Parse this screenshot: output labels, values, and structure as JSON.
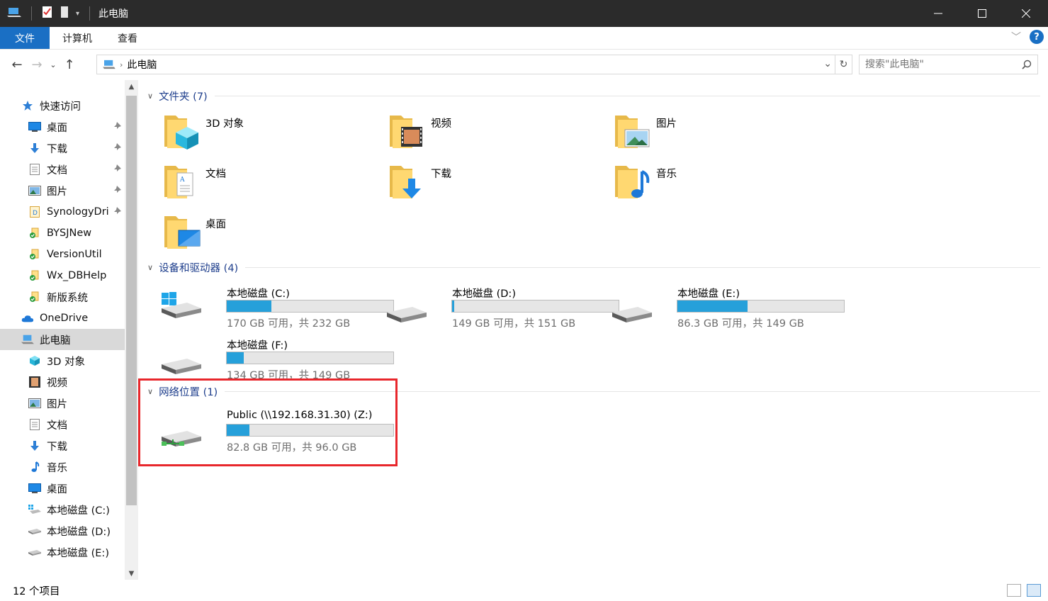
{
  "window": {
    "title": "此电脑"
  },
  "ribbon": {
    "tabs": [
      "文件",
      "计算机",
      "查看"
    ]
  },
  "address": {
    "path": "此电脑"
  },
  "search": {
    "placeholder": "搜索\"此电脑\""
  },
  "sidebar": {
    "items": [
      {
        "label": "快速访问",
        "icon": "star-icon",
        "indent": 0
      },
      {
        "label": "桌面",
        "icon": "desktop-icon",
        "indent": 1,
        "pinned": true
      },
      {
        "label": "下载",
        "icon": "download-icon",
        "indent": 1,
        "pinned": true
      },
      {
        "label": "文档",
        "icon": "document-icon",
        "indent": 1,
        "pinned": true
      },
      {
        "label": "图片",
        "icon": "picture-icon",
        "indent": 1,
        "pinned": true
      },
      {
        "label": "SynologyDri",
        "icon": "synology-icon",
        "indent": 1,
        "pinned": true
      },
      {
        "label": "BYSJNew",
        "icon": "synced-folder-icon",
        "indent": 1
      },
      {
        "label": "VersionUtil",
        "icon": "synced-folder-icon",
        "indent": 1
      },
      {
        "label": "Wx_DBHelp",
        "icon": "synced-folder-icon",
        "indent": 1
      },
      {
        "label": "新版系统",
        "icon": "synced-folder-icon",
        "indent": 1
      },
      {
        "label": "OneDrive",
        "icon": "cloud-icon",
        "indent": 0
      },
      {
        "label": "此电脑",
        "icon": "computer-icon",
        "indent": 0,
        "selected": true
      },
      {
        "label": "3D 对象",
        "icon": "cube-icon",
        "indent": 1
      },
      {
        "label": "视频",
        "icon": "video-icon",
        "indent": 1
      },
      {
        "label": "图片",
        "icon": "picture-icon",
        "indent": 1
      },
      {
        "label": "文档",
        "icon": "document-icon",
        "indent": 1
      },
      {
        "label": "下载",
        "icon": "download-icon",
        "indent": 1
      },
      {
        "label": "音乐",
        "icon": "music-icon",
        "indent": 1
      },
      {
        "label": "桌面",
        "icon": "desktop-icon",
        "indent": 1
      },
      {
        "label": "本地磁盘 (C:)",
        "icon": "windows-drive-icon",
        "indent": 1
      },
      {
        "label": "本地磁盘 (D:)",
        "icon": "drive-icon",
        "indent": 1
      },
      {
        "label": "本地磁盘 (E:)",
        "icon": "drive-icon",
        "indent": 1
      }
    ]
  },
  "groups": {
    "folders": {
      "title": "文件夹 (7)"
    },
    "drives": {
      "title": "设备和驱动器 (4)"
    },
    "network": {
      "title": "网络位置 (1)"
    }
  },
  "folders": [
    {
      "name": "3D 对象",
      "overlay": "cube"
    },
    {
      "name": "视频",
      "overlay": "film"
    },
    {
      "name": "图片",
      "overlay": "picture"
    },
    {
      "name": "文档",
      "overlay": "document"
    },
    {
      "name": "下载",
      "overlay": "download"
    },
    {
      "name": "音乐",
      "overlay": "music"
    },
    {
      "name": "桌面",
      "overlay": "desktop"
    }
  ],
  "drives": [
    {
      "name": "本地磁盘 (C:)",
      "free": "170 GB 可用，共 232 GB",
      "used_fraction": 0.267,
      "icon": "windows-drive-icon"
    },
    {
      "name": "本地磁盘 (D:)",
      "free": "149 GB 可用，共 151 GB",
      "used_fraction": 0.013,
      "icon": "drive-icon"
    },
    {
      "name": "本地磁盘 (E:)",
      "free": "86.3 GB 可用，共 149 GB",
      "used_fraction": 0.421,
      "icon": "drive-icon"
    },
    {
      "name": "本地磁盘 (F:)",
      "free": "134 GB 可用，共 149 GB",
      "used_fraction": 0.1,
      "icon": "drive-icon"
    }
  ],
  "network": [
    {
      "name": "Public (\\\\192.168.31.30) (Z:)",
      "free": "82.8 GB 可用，共 96.0 GB",
      "used_fraction": 0.1375,
      "icon": "network-drive-icon"
    }
  ],
  "status": {
    "count": "12 个项目"
  },
  "colors": {
    "accent": "#1a6fc4",
    "bar": "#26a0da",
    "highlight": "#e8272c"
  }
}
